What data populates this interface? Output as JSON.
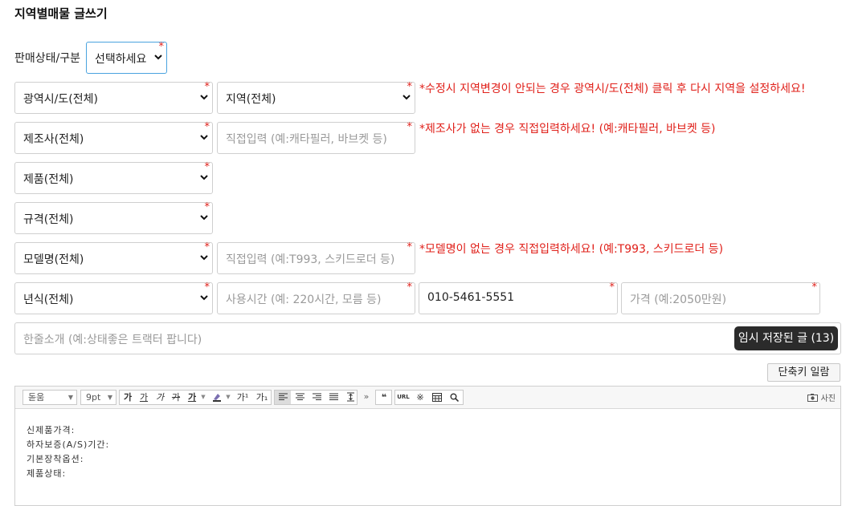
{
  "page": {
    "title": "지역별매물 글쓰기"
  },
  "status": {
    "label": "판매상태/구분",
    "select": "선택하세요"
  },
  "required_mark": "*",
  "fields": {
    "region_province": "광역시/도(전체)",
    "region": "지역(전체)",
    "manufacturer": "제조사(전체)",
    "manufacturer_input_placeholder": "직접입력 (예:캐타필러, 바브켓 등)",
    "product": "제품(전체)",
    "spec": "규격(전체)",
    "model": "모델명(전체)",
    "model_input_placeholder": "직접입력 (예:T993, 스키드로더 등)",
    "year": "년식(전체)",
    "usage_hours_placeholder": "사용시간 (예: 220시간, 모름 등)",
    "phone": "010-5461-5551",
    "price_placeholder": "가격 (예:2050만원)",
    "intro_placeholder": "한줄소개 (예:상태좋은 트랙터 팝니다)"
  },
  "warnings": {
    "region": "*수정시 지역변경이 안되는 경우 광역시/도(전체) 클릭 후 다시 지역을 설정하세요!",
    "manufacturer": "*제조사가 없는 경우 직접입력하세요! (예:캐타필러, 바브켓 등)",
    "model": "*모델명이 없는 경우 직접입력하세요! (예:T993, 스키드로더 등)"
  },
  "buttons": {
    "temp_saved": "임시 저장된 글 (13)",
    "shortcuts": "단축키 일람"
  },
  "editor": {
    "font_select": "돋움",
    "size_select": "9pt",
    "format_buttons": [
      "가",
      "가",
      "가",
      "가",
      "가"
    ],
    "superscript": "가¹",
    "subscript": "가₁",
    "photo_label": "사진",
    "url_label": "URL",
    "quote_label": "❝",
    "body_lines": [
      "신제품가격:",
      "하자보증(A/S)기간:",
      "기본장착옵션:",
      "제품상태:"
    ]
  }
}
